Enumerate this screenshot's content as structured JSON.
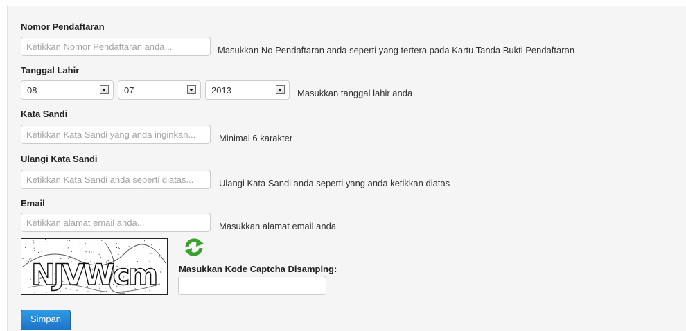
{
  "form": {
    "nomor": {
      "label": "Nomor Pendaftaran",
      "placeholder": "Ketikkan Nomor Pendaftaran anda...",
      "value": "",
      "help": "Masukkan No Pendaftaran anda seperti yang tertera pada Kartu Tanda Bukti Pendaftaran"
    },
    "tanggal": {
      "label": "Tanggal Lahir",
      "day": "08",
      "month": "07",
      "year": "2013",
      "help": "Masukkan tanggal lahir anda"
    },
    "sandi": {
      "label": "Kata Sandi",
      "placeholder": "Ketikkan Kata Sandi yang anda inginkan...",
      "value": "",
      "help": "Minimal 6 karakter"
    },
    "ulangi": {
      "label": "Ulangi Kata Sandi",
      "placeholder": "Ketikkan Kata Sandi anda seperti diatas...",
      "value": "",
      "help": "Ulangi Kata Sandi anda seperti yang anda ketikkan diatas"
    },
    "email": {
      "label": "Email",
      "placeholder": "Ketikkan alamat email anda...",
      "value": "",
      "help": "Masukkan alamat email anda"
    },
    "captcha": {
      "text": "NJVWcm",
      "label": "Masukkan Kode Captcha Disamping:",
      "value": "",
      "refresh_icon": "refresh-icon"
    },
    "submit_label": "Simpan"
  },
  "colors": {
    "panel": "#f5f5f5",
    "button": "#2a8ad4",
    "refresh": "#3aa12c"
  }
}
